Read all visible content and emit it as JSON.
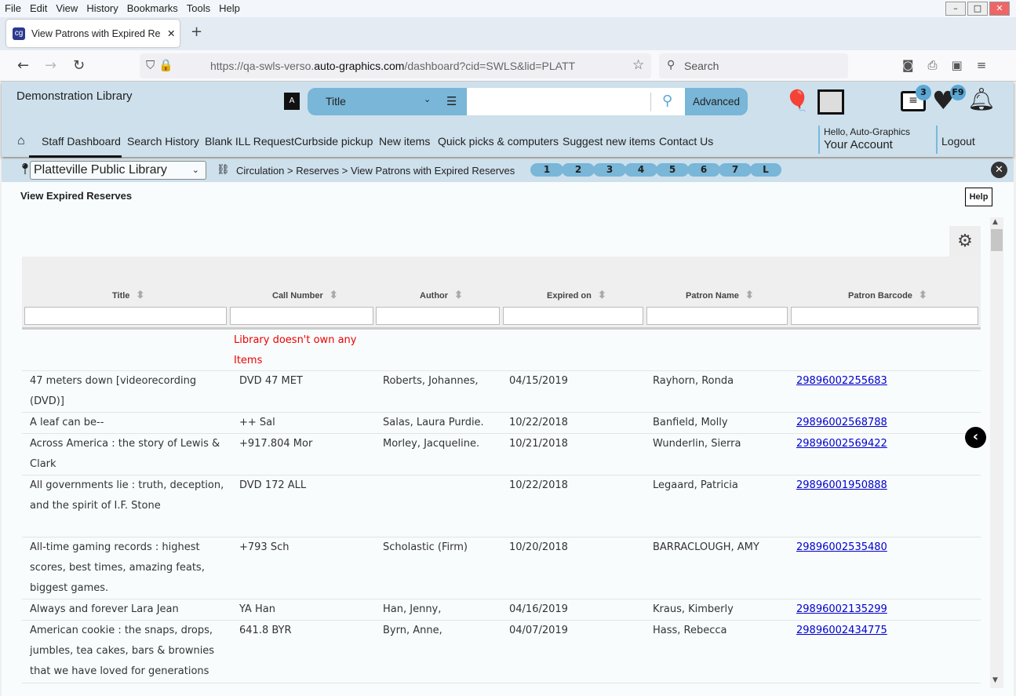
{
  "browser": {
    "menu": [
      "File",
      "Edit",
      "View",
      "History",
      "Bookmarks",
      "Tools",
      "Help"
    ],
    "tab_title": "View Patrons with Expired Reser",
    "url_pre": "https://qa-swls-verso.",
    "url_domain": "auto-graphics.com",
    "url_post": "/dashboard?cid=SWLS&lid=PLATT",
    "search_placeholder": "Search"
  },
  "header": {
    "library": "Demonstration Library",
    "search_type": "Title",
    "search_value": "",
    "advanced": "Advanced",
    "list_badge": "3",
    "fav_badge": "F9",
    "hello": "Hello, Auto-Graphics",
    "account": "Your Account",
    "logout": "Logout"
  },
  "nav": [
    "Staff Dashboard",
    "Search History",
    "Blank ILL Request",
    "Curbside pickup",
    "New items",
    "Quick picks & computers",
    "Suggest new items",
    "Contact Us"
  ],
  "location": "Platteville Public Library",
  "breadcrumb": "Circulation > Reserves > View Patrons with Expired Reserves",
  "pages": [
    "1",
    "2",
    "3",
    "4",
    "5",
    "6",
    "7",
    "L"
  ],
  "page_title": "View Expired Reserves",
  "help": "Help",
  "columns": [
    "Title",
    "Call Number",
    "Author",
    "Expired on",
    "Patron Name",
    "Patron Barcode"
  ],
  "notice": "Library doesn't own any Items",
  "rows": [
    {
      "title": "47 meters down [videorecording (DVD)]",
      "call": "DVD 47 MET",
      "author": "Roberts, Johannes,",
      "expired": "04/15/2019",
      "patron": "Rayhorn, Ronda",
      "barcode": "29896002255683"
    },
    {
      "title": "A leaf can be--",
      "call": "++ Sal",
      "author": "Salas, Laura Purdie.",
      "expired": "10/22/2018",
      "patron": "Banfield, Molly",
      "barcode": "29896002568788"
    },
    {
      "title": "Across America : the story of Lewis & Clark",
      "call": "+917.804 Mor",
      "author": "Morley, Jacqueline.",
      "expired": "10/21/2018",
      "patron": "Wunderlin, Sierra",
      "barcode": "29896002569422"
    },
    {
      "title": "All governments lie : truth, deception, and the spirit of I.F. Stone",
      "call": "DVD 172 ALL",
      "author": "",
      "expired": "10/22/2018",
      "patron": "Legaard, Patricia",
      "barcode": "29896001950888"
    },
    {
      "title": "All-time gaming records : highest scores, best times, amazing feats, biggest games.",
      "call": "+793 Sch",
      "author": "Scholastic (Firm)",
      "expired": "10/20/2018",
      "patron": "BARRACLOUGH, AMY",
      "barcode": "29896002535480"
    },
    {
      "title": "Always and forever Lara Jean",
      "call": "YA Han",
      "author": "Han, Jenny,",
      "expired": "04/16/2019",
      "patron": "Kraus, Kimberly",
      "barcode": "29896002135299"
    },
    {
      "title": "American cookie : the snaps, drops, jumbles, tea cakes, bars & brownies that we have loved for generations",
      "call": "641.8 BYR",
      "author": "Byrn, Anne,",
      "expired": "04/07/2019",
      "patron": "Hass, Rebecca",
      "barcode": "29896002434775"
    }
  ]
}
